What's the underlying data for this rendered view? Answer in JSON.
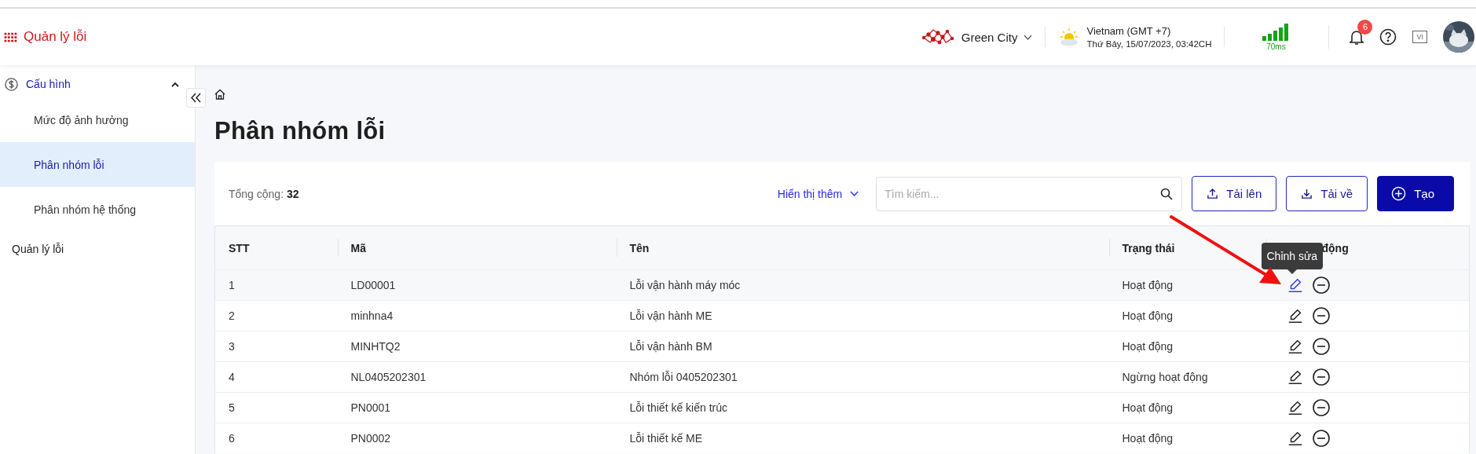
{
  "app": {
    "title": "Quản lý lỗi"
  },
  "header": {
    "site": "Green City",
    "location": "Vietnam (GMT +7)",
    "datetime": "Thứ Bảy, 15/07/2023, 03:42CH",
    "latency": "70ms",
    "notifications": "6",
    "language": "VI"
  },
  "sidebar": {
    "items": [
      {
        "kind": "group",
        "label": "Cấu hình",
        "expanded": true,
        "selected": false,
        "children": [
          {
            "label": "Mức độ ảnh hưởng",
            "selected": false
          },
          {
            "label": "Phân nhóm lỗi",
            "selected": true
          },
          {
            "label": "Phân nhóm hệ thống",
            "selected": false
          }
        ]
      },
      {
        "kind": "link",
        "label": "Quản lý lỗi",
        "selected": false
      }
    ]
  },
  "page": {
    "title": "Phân nhóm lỗi",
    "total": "Tổng cộng: **32**",
    "more": "Hiển thị thêm",
    "search": {
      "placeholder": "Tìm kiếm..."
    },
    "buttons": [
      {
        "kind": "upload",
        "label": "Tải lên"
      },
      {
        "kind": "download",
        "label": "Tải về"
      },
      {
        "kind": "create",
        "label": "Tạo"
      }
    ]
  },
  "table": {
    "columns": [
      "STT",
      "Mã",
      "Tên",
      "Trạng thái",
      "động"
    ],
    "rows": [
      {
        "cells": [
          "1",
          "LD00001",
          "Lỗi vận hành máy móc",
          "Hoạt động"
        ],
        "hovered": true
      },
      {
        "cells": [
          "2",
          "minhna4",
          "Lỗi vận hành ME",
          "Hoạt động"
        ],
        "hovered": false
      },
      {
        "cells": [
          "3",
          "MINHTQ2",
          "Lỗi vận hành BM",
          "Hoạt động"
        ],
        "hovered": false
      },
      {
        "cells": [
          "4",
          "NL0405202301",
          "Nhóm lỗi 0405202301",
          "Ngừng hoạt động"
        ],
        "hovered": false
      },
      {
        "cells": [
          "5",
          "PN0001",
          "Lỗi thiết kế kiến trúc",
          "Hoạt động"
        ],
        "hovered": false
      },
      {
        "cells": [
          "6",
          "PN0002",
          "Lỗi thiết kế ME",
          "Hoạt động"
        ],
        "hovered": false
      }
    ],
    "tooltip": "Chỉnh sửa"
  }
}
